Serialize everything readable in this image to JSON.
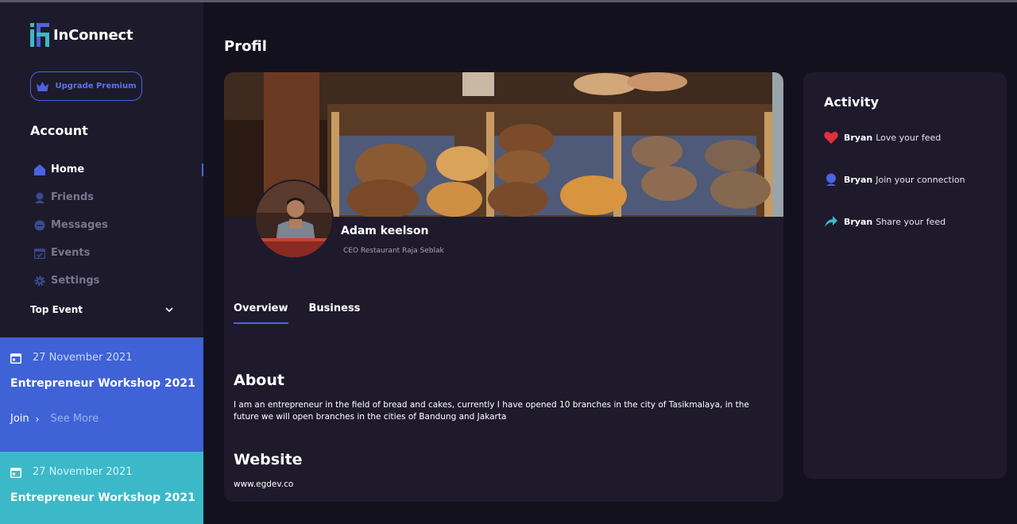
{
  "app": {
    "name": "InConnect"
  },
  "sidebar": {
    "premium_label": "Upgrade Premium",
    "account_title": "Account",
    "nav": [
      {
        "label": "Home",
        "icon": "home-icon",
        "active": true
      },
      {
        "label": "Friends",
        "icon": "friends-icon",
        "active": false
      },
      {
        "label": "Messages",
        "icon": "messages-icon",
        "active": false
      },
      {
        "label": "Events",
        "icon": "calendar-check-icon",
        "active": false
      },
      {
        "label": "Settings",
        "icon": "gear-icon",
        "active": false
      }
    ],
    "top_event_label": "Top Event",
    "events": [
      {
        "date": "27 November 2021",
        "title": "Entrepreneur Workshop 2021",
        "join_label": "Join",
        "more_label": "See More",
        "color": "#3f62d6"
      },
      {
        "date": "27 November 2021",
        "title": "Entrepreneur Workshop 2021",
        "color": "#3bb9c8"
      }
    ]
  },
  "main": {
    "page_title": "Profil",
    "profile": {
      "name": "Adam keelson",
      "role": "CEO Restaurant Raja Seblak"
    },
    "tabs": [
      {
        "label": "Overview",
        "active": true
      },
      {
        "label": "Business",
        "active": false
      }
    ],
    "about_title": "About",
    "about_text": "I am an entrepreneur in the field of bread and cakes, currently I have opened 10 branches in the city of Tasikmalaya, in the future we will open branches in the cities of Bandung and Jakarta",
    "website_title": "Website",
    "website_url": "www.egdev.co"
  },
  "activity": {
    "title": "Activity",
    "items": [
      {
        "user": "Bryan",
        "text": "Love your feed",
        "icon": "heart-icon",
        "color": "#e0303c"
      },
      {
        "user": "Bryan",
        "text": "Join your connection",
        "icon": "user-icon",
        "color": "#4a63e0"
      },
      {
        "user": "Bryan",
        "text": "Share your feed",
        "icon": "share-icon",
        "color": "#3bb9c8"
      }
    ]
  },
  "colors": {
    "accent": "#4a63e0",
    "background": "#14111f",
    "card": "#1e1a2c",
    "sidebar": "#1d1a2b"
  }
}
